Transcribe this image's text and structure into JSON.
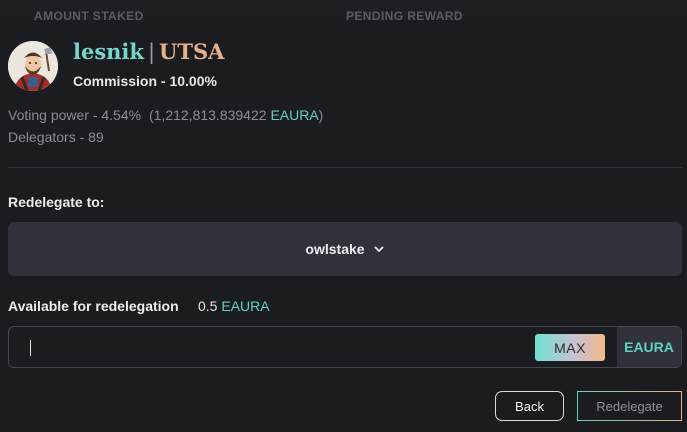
{
  "background_table": {
    "col_amount": "AMOUNT STAKED",
    "col_pending": "PENDING REWARD"
  },
  "validator": {
    "name": "lesnik",
    "separator": "|",
    "tag": "UTSA",
    "commission": "Commission - 10.00%",
    "voting_power_label": "Voting power - 4.54%",
    "voting_power_open": "(1,212,813.839422",
    "voting_power_denom": "EAURA",
    "voting_power_close": ")",
    "delegators": "Delegators - 89"
  },
  "redelegate": {
    "label": "Redelegate to:",
    "selected_validator": "owlstake",
    "available_label": "Available for redelegation",
    "available_amount": "0.5",
    "available_denom": "EAURA",
    "amount_value": "",
    "amount_placeholder": "",
    "max_label": "MAX",
    "unit": "EAURA"
  },
  "actions": {
    "back_label": "Back",
    "redelegate_label": "Redelegate"
  },
  "icons": {
    "dropdown": "chevron-down-icon"
  },
  "colors": {
    "accent": "#5fd2c0",
    "tag": "#e8b087",
    "background": "#1b1c20",
    "panel": "#303139"
  }
}
